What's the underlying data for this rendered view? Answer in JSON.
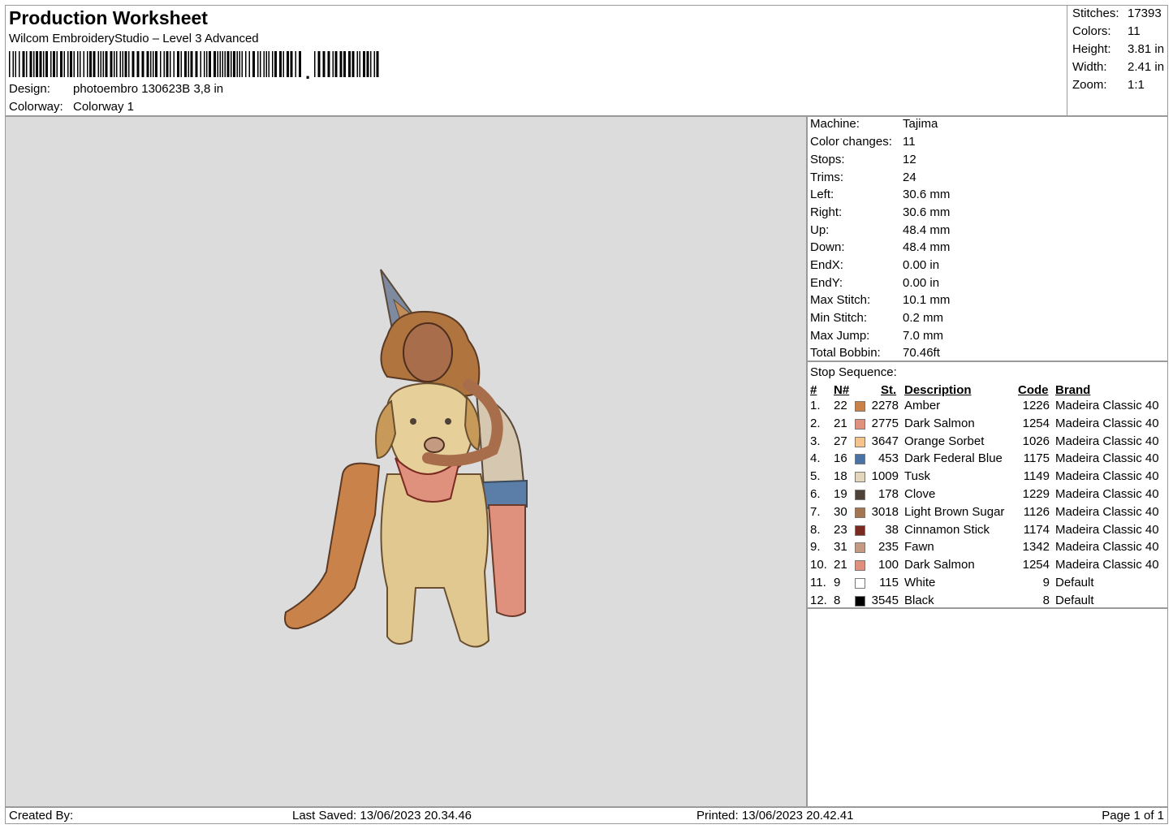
{
  "header": {
    "title": "Production Worksheet",
    "software": "Wilcom EmbroideryStudio – Level 3 Advanced",
    "barcode_comma": ",",
    "design_label": "Design:",
    "design_value": "photoembro 130623B 3,8 in",
    "colorway_label": "Colorway:",
    "colorway_value": "Colorway 1"
  },
  "stats": [
    {
      "label": "Stitches:",
      "value": "17393"
    },
    {
      "label": "Colors:",
      "value": "11"
    },
    {
      "label": "Height:",
      "value": "3.81 in"
    },
    {
      "label": "Width:",
      "value": "2.41 in"
    },
    {
      "label": "Zoom:",
      "value": "1:1"
    }
  ],
  "machine_info": [
    {
      "label": "Machine:",
      "value": "Tajima"
    },
    {
      "label": "Color changes:",
      "value": "11"
    },
    {
      "label": "Stops:",
      "value": "12"
    },
    {
      "label": "Trims:",
      "value": "24"
    },
    {
      "label": "Left:",
      "value": "30.6 mm"
    },
    {
      "label": "Right:",
      "value": "30.6 mm"
    },
    {
      "label": "Up:",
      "value": "48.4 mm"
    },
    {
      "label": "Down:",
      "value": "48.4 mm"
    },
    {
      "label": "EndX:",
      "value": "0.00 in"
    },
    {
      "label": "EndY:",
      "value": "0.00 in"
    },
    {
      "label": "Max Stitch:",
      "value": "10.1 mm"
    },
    {
      "label": "Min Stitch:",
      "value": "0.2 mm"
    },
    {
      "label": "Max Jump:",
      "value": "7.0 mm"
    },
    {
      "label": "Total Bobbin:",
      "value": "70.46ft"
    }
  ],
  "stop_sequence": {
    "title": "Stop Sequence:",
    "headers": {
      "num": "#",
      "n": "N#",
      "st": "St.",
      "description": "Description",
      "code": "Code",
      "brand": "Brand"
    },
    "rows": [
      {
        "num": "1.",
        "n": "22",
        "st": "2278",
        "description": "Amber",
        "code": "1226",
        "brand": "Madeira Classic 40",
        "color": "#c8824a"
      },
      {
        "num": "2.",
        "n": "21",
        "st": "2775",
        "description": "Dark Salmon",
        "code": "1254",
        "brand": "Madeira Classic 40",
        "color": "#e0917e"
      },
      {
        "num": "3.",
        "n": "27",
        "st": "3647",
        "description": "Orange Sorbet",
        "code": "1026",
        "brand": "Madeira Classic 40",
        "color": "#f5c48c"
      },
      {
        "num": "4.",
        "n": "16",
        "st": "453",
        "description": "Dark Federal Blue",
        "code": "1175",
        "brand": "Madeira Classic 40",
        "color": "#4a72a2"
      },
      {
        "num": "5.",
        "n": "18",
        "st": "1009",
        "description": "Tusk",
        "code": "1149",
        "brand": "Madeira Classic 40",
        "color": "#e4d6bc"
      },
      {
        "num": "6.",
        "n": "19",
        "st": "178",
        "description": "Clove",
        "code": "1229",
        "brand": "Madeira Classic 40",
        "color": "#4d4138"
      },
      {
        "num": "7.",
        "n": "30",
        "st": "3018",
        "description": "Light Brown Sugar",
        "code": "1126",
        "brand": "Madeira Classic 40",
        "color": "#a47550"
      },
      {
        "num": "8.",
        "n": "23",
        "st": "38",
        "description": "Cinnamon Stick",
        "code": "1174",
        "brand": "Madeira Classic 40",
        "color": "#7b2a22"
      },
      {
        "num": "9.",
        "n": "31",
        "st": "235",
        "description": "Fawn",
        "code": "1342",
        "brand": "Madeira Classic 40",
        "color": "#c49a80"
      },
      {
        "num": "10.",
        "n": "21",
        "st": "100",
        "description": "Dark Salmon",
        "code": "1254",
        "brand": "Madeira Classic 40",
        "color": "#e0917e"
      },
      {
        "num": "11.",
        "n": "9",
        "st": "115",
        "description": "White",
        "code": "9",
        "brand": "Default",
        "color": "#ffffff"
      },
      {
        "num": "12.",
        "n": "8",
        "st": "3545",
        "description": "Black",
        "code": "8",
        "brand": "Default",
        "color": "#000000"
      }
    ]
  },
  "footer": {
    "created_by": "Created By:",
    "last_saved": "Last Saved: 13/06/2023 20.34.46",
    "printed": "Printed: 13/06/2023 20.42.41",
    "page": "Page 1 of 1"
  },
  "colors": {
    "preview_background": "#dcdcdc",
    "border": "#9a9a9a"
  }
}
